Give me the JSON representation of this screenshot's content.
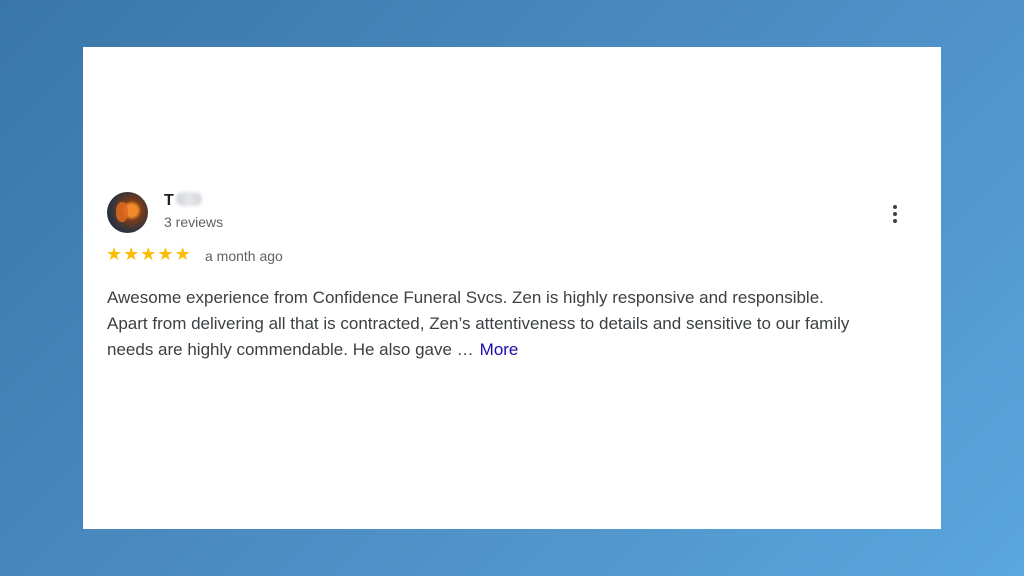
{
  "review": {
    "reviewer_name": "T",
    "review_count": "3 reviews",
    "rating": 5,
    "stars": [
      "★",
      "★",
      "★",
      "★",
      "★"
    ],
    "date": "a month ago",
    "text_lines": [
      "Awesome experience from Confidence Funeral Svcs. Zen is highly responsive and responsible.",
      "Apart from delivering all that is contracted, Zen’s attentiveness to details and sensitive to our family",
      "needs are highly commendable. He also gave …"
    ],
    "more_label": "More"
  },
  "icons": {
    "menu": "more-vert-icon",
    "avatar": "profile-photo"
  },
  "colors": {
    "star": "#fbbc04",
    "link": "#1a0dab",
    "text": "#3c4043",
    "muted": "#5f6368",
    "background_start": "#3a77a8",
    "background_end": "#5aa6df"
  }
}
